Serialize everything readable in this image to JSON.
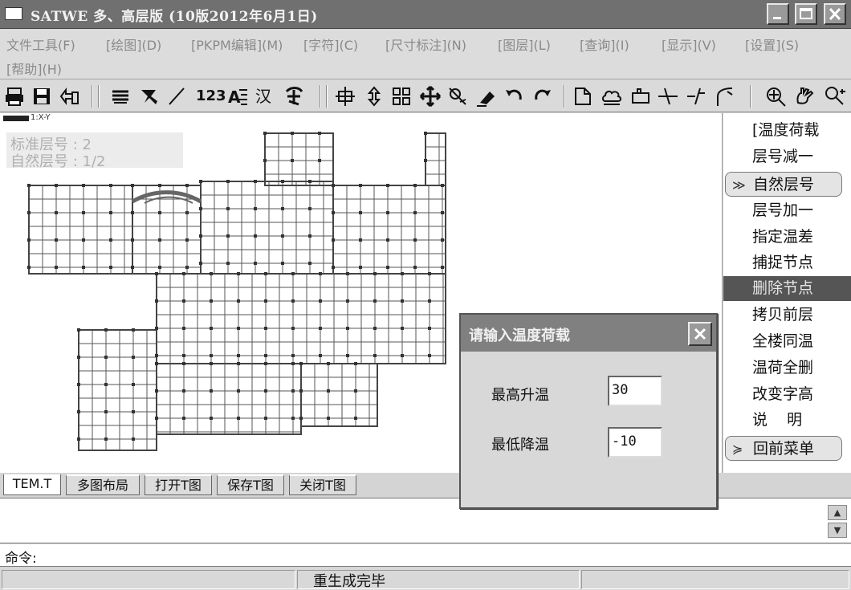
{
  "window": {
    "title": "SATWE 多、高层版 (10版2012年6月1日)"
  },
  "menu": {
    "items": [
      "文件工具(F)",
      "[绘图](D)",
      "[PKPM编辑](M)",
      "[字符](C)",
      "[尺寸标注](N)",
      "[图层](L)",
      "[查询](I)",
      "[显示](V)",
      "[设置](S)",
      "[帮助](H)"
    ]
  },
  "toolbar": {
    "icons": [
      "print-icon",
      "save-icon",
      "export-icon",
      "layer-props-icon",
      "pick-icon",
      "line-icon",
      "number-icon",
      "text-style-icon",
      "chinese-text-icon",
      "font-icon",
      "crosshair-icon",
      "vertical-move-icon",
      "grid-icon",
      "move-icon",
      "snap-icon",
      "erase-icon",
      "undo-icon",
      "redo-icon",
      "page-icon",
      "cloud-icon",
      "rect-icon",
      "trim-icon",
      "extend-icon",
      "fillet-icon",
      "zoom-icon",
      "pan-icon",
      "zoom-extent-icon"
    ],
    "number_label": "123",
    "text_label": "汉"
  },
  "canvas": {
    "scale_text": "1:X-Y",
    "standard_floor_label": "标准层号 :  2",
    "natural_floor_label": "自然层号 :  1/2"
  },
  "side_menu": {
    "items": [
      {
        "label": "[温度荷载"
      },
      {
        "label": "层号减一"
      },
      {
        "label": "自然层号"
      },
      {
        "label": "层号加一"
      },
      {
        "label": "指定温差"
      },
      {
        "label": "捕捉节点"
      },
      {
        "label": "删除节点"
      },
      {
        "label": "拷贝前层"
      },
      {
        "label": "全楼同温"
      },
      {
        "label": "温荷全删"
      },
      {
        "label": "改变字高"
      },
      {
        "label": "说    明"
      },
      {
        "label": "回前菜单"
      }
    ],
    "chevron": "≫",
    "chevron_down": "≽"
  },
  "tabs": [
    "TEM.T",
    "多图布局",
    "打开T图",
    "保存T图",
    "关闭T图"
  ],
  "command": {
    "label": "命令:"
  },
  "status": {
    "text": "重生成完毕"
  },
  "dialog": {
    "title": "请输入温度荷载",
    "max_temp_label": "最高升温",
    "max_temp_value": "30",
    "min_temp_label": "最低降温",
    "min_temp_value": "-10"
  },
  "colors": {
    "titlebar": "#707070",
    "selected_item": "#555555",
    "grid_line": "#555555"
  }
}
